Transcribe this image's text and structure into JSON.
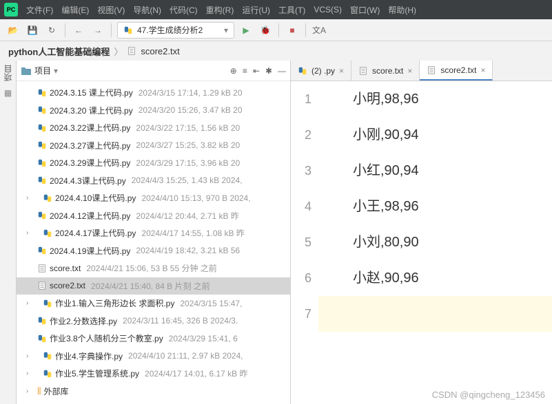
{
  "menubar": {
    "items": [
      "文件(F)",
      "编辑(E)",
      "视图(V)",
      "导航(N)",
      "代码(C)",
      "重构(R)",
      "运行(U)",
      "工具(T)",
      "VCS(S)",
      "窗口(W)",
      "帮助(H)"
    ]
  },
  "run_config": "47.学生成绩分析2",
  "breadcrumb": {
    "root": "python人工智能基础编程",
    "file": "score2.txt"
  },
  "side_label": "项目",
  "panel_title": "项目",
  "tree": [
    {
      "name": "2024.3.15 课上代码.py",
      "meta": "2024/3/15 17:14, 1.29 kB 20",
      "type": "py"
    },
    {
      "name": "2024.3.20 课上代码.py",
      "meta": "2024/3/20 15:26, 3.47 kB 20",
      "type": "py"
    },
    {
      "name": "2024.3.22课上代码.py",
      "meta": "2024/3/22 17:15, 1.56 kB 20",
      "type": "py"
    },
    {
      "name": "2024.3.27课上代码.py",
      "meta": "2024/3/27 15:25, 3.82 kB 20",
      "type": "py"
    },
    {
      "name": "2024.3.29课上代码.py",
      "meta": "2024/3/29 17:15, 3.96 kB 20",
      "type": "py"
    },
    {
      "name": "2024.4.3课上代码.py",
      "meta": "2024/4/3 15:25, 1.43 kB 2024,",
      "type": "py"
    },
    {
      "name": "2024.4.10课上代码.py",
      "meta": "2024/4/10 15:13, 970 B 2024,",
      "type": "py",
      "arrow": true
    },
    {
      "name": "2024.4.12课上代码.py",
      "meta": "2024/4/12 20:44, 2.71 kB 昨",
      "type": "py"
    },
    {
      "name": "2024.4.17课上代码.py",
      "meta": "2024/4/17 14:55, 1.08 kB 昨",
      "type": "py",
      "arrow": true
    },
    {
      "name": "2024.4.19课上代码.py",
      "meta": "2024/4/19 18:42, 3.21 kB 56",
      "type": "py"
    },
    {
      "name": "score.txt",
      "meta": "2024/4/21 15:06, 53 B 55 分钟 之前",
      "type": "txt"
    },
    {
      "name": "score2.txt",
      "meta": "2024/4/21 15:40, 84 B 片刻 之前",
      "type": "txt",
      "selected": true
    },
    {
      "name": "作业1.输入三角形边长 求面积.py",
      "meta": "2024/3/15 15:47,",
      "type": "py",
      "arrow": true
    },
    {
      "name": "作业2.分数选择.py",
      "meta": "2024/3/11 16:45, 326 B 2024/3.",
      "type": "py"
    },
    {
      "name": "作业3.8个人随机分三个教室.py",
      "meta": "2024/3/29 15:41, 6",
      "type": "py"
    },
    {
      "name": "作业4.字典操作.py",
      "meta": "2024/4/10 21:11, 2.97 kB 2024,",
      "type": "py",
      "arrow": true
    },
    {
      "name": "作业5.学生管理系统.py",
      "meta": "2024/4/17 14:01, 6.17 kB 昨",
      "type": "py",
      "arrow": true
    }
  ],
  "external_lib": "外部库",
  "tabs": [
    {
      "label": "(2) .py",
      "type": "py"
    },
    {
      "label": "score.txt",
      "type": "txt"
    },
    {
      "label": "score2.txt",
      "type": "txt",
      "active": true
    }
  ],
  "editor_lines": [
    "小明,98,96",
    "小刚,90,94",
    "小红,90,94",
    "小王,98,96",
    "小刘,80,90",
    "小赵,90,96",
    ""
  ],
  "watermark": "CSDN @qingcheng_123456"
}
